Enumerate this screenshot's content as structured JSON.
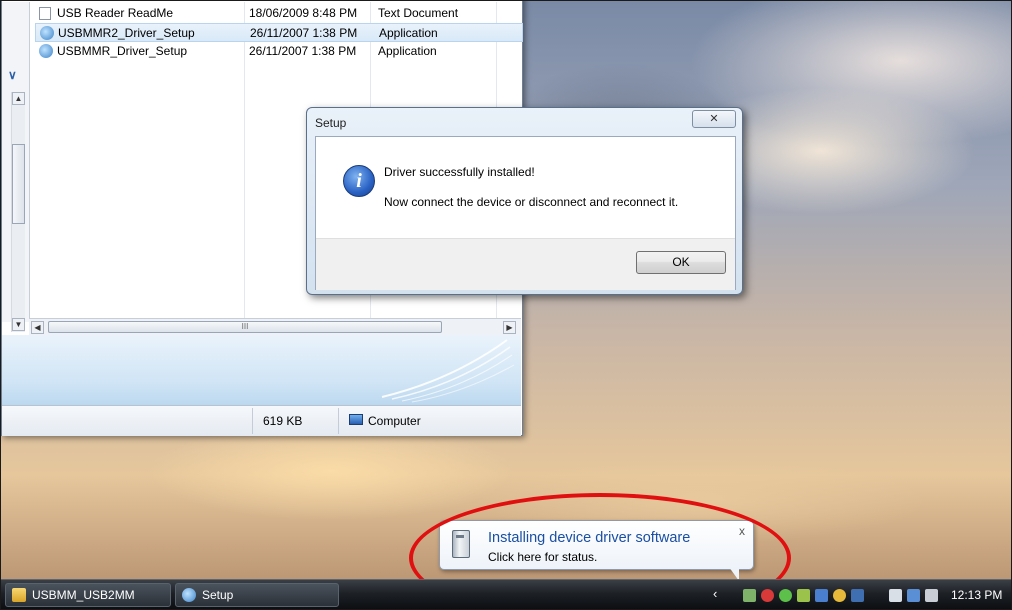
{
  "explorer": {
    "files": [
      {
        "name": "USB Reader ReadMe",
        "date": "18/06/2009 8:48 PM",
        "type": "Text Document",
        "icon": "text-document-icon"
      },
      {
        "name": "USBMMR2_Driver_Setup",
        "date": "26/11/2007 1:38 PM",
        "type": "Application",
        "icon": "setup-application-icon",
        "selected": true
      },
      {
        "name": "USBMMR_Driver_Setup",
        "date": "26/11/2007 1:38 PM",
        "type": "Application",
        "icon": "setup-application-icon"
      }
    ],
    "hscroll_grip": "III",
    "status": {
      "size": "619 KB",
      "location": "Computer"
    }
  },
  "dialog": {
    "title": "Setup",
    "close_glyph": "✕",
    "icon_glyph": "i",
    "message_line1": "Driver successfully installed!",
    "message_line2": "Now connect the device or disconnect and reconnect it.",
    "ok_label": "OK"
  },
  "balloon": {
    "title": "Installing device driver software",
    "subtitle": "Click here for status.",
    "close_glyph": "x"
  },
  "taskbar": {
    "buttons": [
      {
        "label": "USBMM_USB2MM",
        "icon": "folder-icon"
      },
      {
        "label": "Setup",
        "icon": "setup-icon"
      }
    ],
    "tray_arrow": "‹",
    "clock": "12:13 PM"
  },
  "colors": {
    "annotation_ellipse": "#e01010",
    "balloon_title": "#1a4fa3"
  }
}
